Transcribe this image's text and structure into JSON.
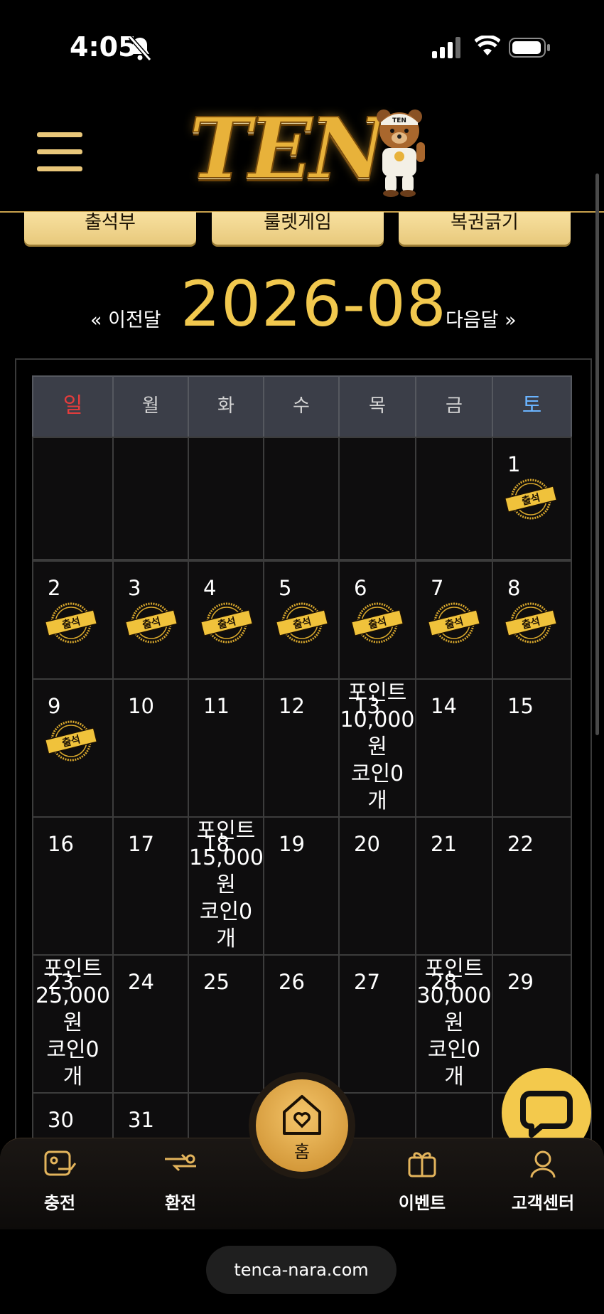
{
  "status_bar": {
    "time": "4:05"
  },
  "header": {
    "logo_text": "TEN",
    "bear_badge": "TEN"
  },
  "nav_buttons": [
    "출석부",
    "룰렛게임",
    "복권긁기"
  ],
  "month_nav": {
    "prev": "« 이전달",
    "current": "2026-08",
    "next": "다음달 »"
  },
  "calendar": {
    "weekdays": [
      "일",
      "월",
      "화",
      "수",
      "목",
      "금",
      "토"
    ],
    "stamp_label": "출석",
    "days": {
      "d1": "1",
      "d2": "2",
      "d3": "3",
      "d4": "4",
      "d5": "5",
      "d6": "6",
      "d7": "7",
      "d8": "8",
      "d9": "9",
      "d10": "10",
      "d11": "11",
      "d12": "12",
      "d13": "13",
      "d14": "14",
      "d15": "15",
      "d16": "16",
      "d17": "17",
      "d18": "18",
      "d19": "19",
      "d20": "20",
      "d21": "21",
      "d22": "22",
      "d23": "23",
      "d24": "24",
      "d25": "25",
      "d26": "26",
      "d27": "27",
      "d28": "28",
      "d29": "29",
      "d30": "30",
      "d31": "31"
    },
    "rewards": {
      "d13": [
        "포인트",
        "10,000",
        "원",
        "코인0",
        "개"
      ],
      "d18": [
        "포인트",
        "15,000",
        "원",
        "코인0",
        "개"
      ],
      "d23": [
        "포인트",
        "25,000",
        "원",
        "코인0",
        "개"
      ],
      "d28": [
        "포인트",
        "30,000",
        "원",
        "코인0",
        "개"
      ]
    },
    "weekday_colors": {
      "sun": "#e53c3c",
      "sat": "#6ab4ff",
      "default": "#d4d4d4"
    }
  },
  "tab_bar": {
    "charge": "충전",
    "exchange": "환전",
    "home": "홈",
    "event": "이벤트",
    "support": "고객센터"
  },
  "browser": {
    "url": "tenca-nara.com"
  },
  "colors": {
    "accent": "#f1c84e",
    "button": "#f3d88d"
  }
}
